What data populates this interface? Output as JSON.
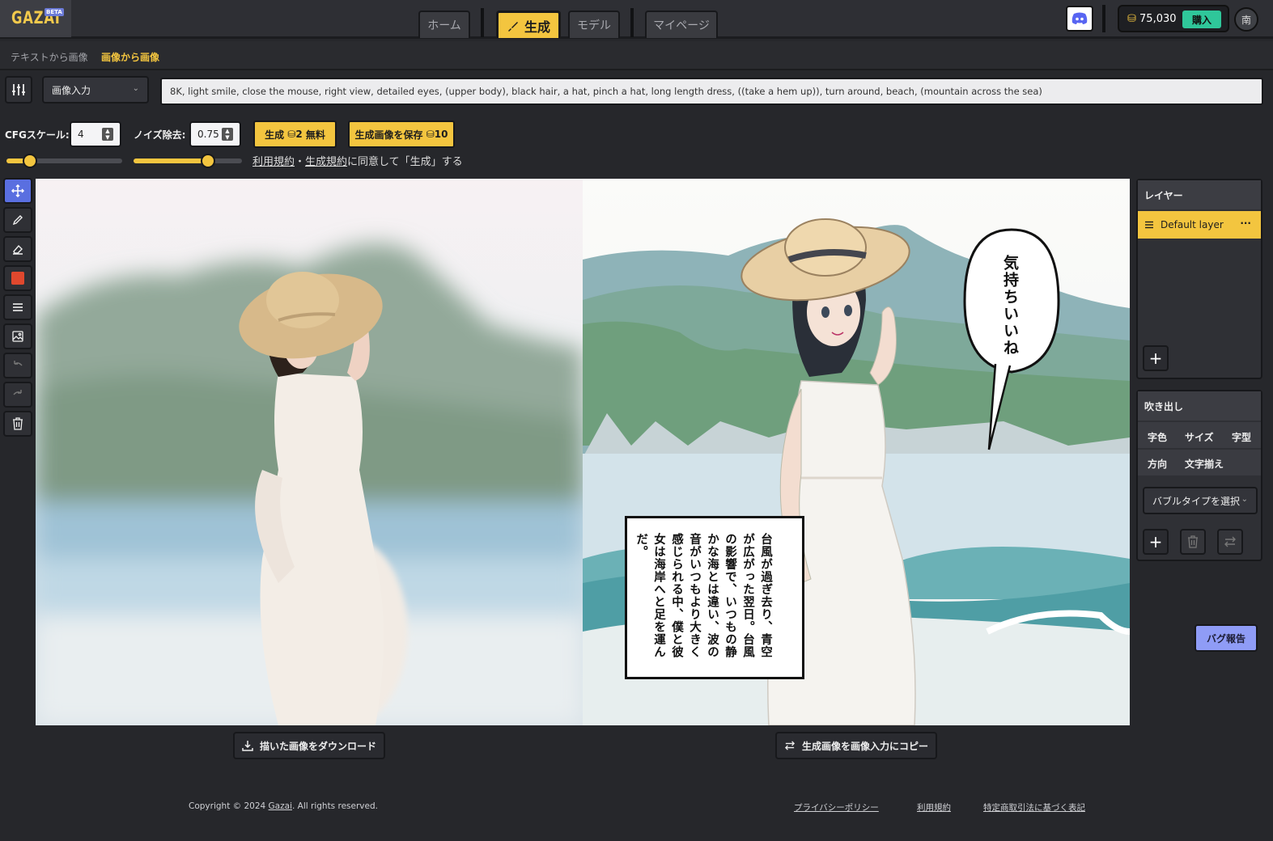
{
  "app": {
    "logo": "GAZAI",
    "beta_badge": "BETA"
  },
  "nav": {
    "tabs": [
      {
        "label": "ホーム",
        "active": false
      },
      {
        "label": "生成",
        "active": true
      },
      {
        "label": "モデル",
        "active": false
      },
      {
        "label": "マイページ",
        "active": false
      }
    ]
  },
  "account": {
    "coins": "75,030",
    "buy_label": "購入",
    "avatar_initial": "南"
  },
  "subtabs": {
    "text_to_image": "テキストから画像",
    "image_to_image": "画像から画像"
  },
  "controls": {
    "mode_select": "画像入力",
    "prompt": "8K, light smile, close the mouse, right view, detailed eyes, (upper body), black hair, a hat, pinch a hat, long length dress, ((take a hem up)), turn around, beach, (mountain across the sea)",
    "cfg_label": "CFGスケール:",
    "cfg_value": "4",
    "noise_label": "ノイズ除去:",
    "noise_value": "0.75",
    "generate_label": "生成",
    "generate_cost": "2",
    "generate_free": "無料",
    "save_label": "生成画像を保存",
    "save_cost": "10",
    "cfg_slider_fraction": 0.2,
    "noise_slider_fraction": 0.69,
    "agree_terms": "利用規約",
    "agree_sep": "・",
    "agree_gen_terms": "生成規約",
    "agree_suffix": "に同意して「生成」する"
  },
  "canvas": {
    "speech_bubble": "気持ちいいね",
    "narration": "台風が過ぎ去り、青空が広がった翌日。台風の影響で、いつもの静かな海とは違い、波の音がいつもより大きく感じられる中、僕と彼女は海岸へと足を運んだ。"
  },
  "layers_panel": {
    "title": "レイヤー",
    "layers": [
      {
        "name": "Default layer",
        "selected": true
      }
    ],
    "more_glyph": "···",
    "add_glyph": "+"
  },
  "bubble_panel": {
    "title": "吹き出し",
    "options_row1": [
      "字色",
      "サイズ",
      "字型"
    ],
    "options_row2": [
      "方向",
      "文字揃え"
    ],
    "type_select": "バブルタイプを選択"
  },
  "buttons": {
    "bug_report": "バグ報告",
    "download": "描いた画像をダウンロード",
    "copy_to_input": "生成画像を画像入力にコピー"
  },
  "footer": {
    "copyright_prefix": "Copyright © 2024 ",
    "copyright_link": "Gazai",
    "copyright_suffix": ". All rights reserved.",
    "privacy": "プライバシーポリシー",
    "terms": "利用規約",
    "commercial": "特定商取引法に基づく表記"
  },
  "colors": {
    "accent": "#f3c53f",
    "active_tool": "#5a6fe0",
    "buy": "#2fc79a",
    "bug": "#8f9cf6",
    "color_swatch": "#e0482e"
  }
}
